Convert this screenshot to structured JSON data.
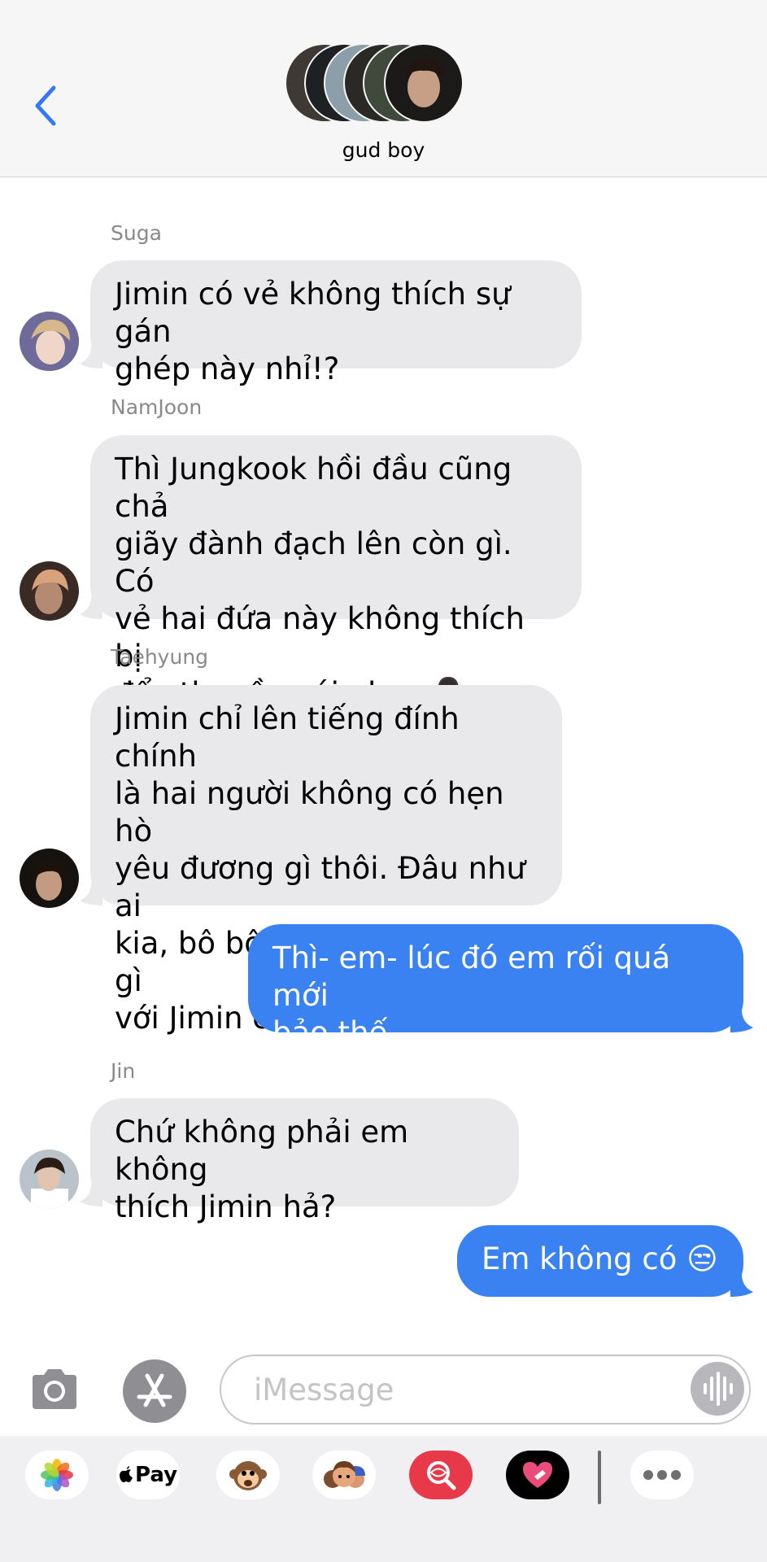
{
  "header": {
    "group_name": "gud boy",
    "back_icon": "chevron-left-icon"
  },
  "messages": [
    {
      "sender": "Suga",
      "text_lines": [
        "Jimin có vẻ không thích sự gán",
        "ghép này nhỉ!?"
      ]
    },
    {
      "sender": "NamJoon",
      "text_lines": [
        "Thì Jungkook hồi đầu cũng chả",
        "giãy đành đạch lên còn gì. Có",
        "vẻ hai đứa này không thích bị",
        "đẩy thuyền với nhau 💁🏻‍♂️"
      ]
    },
    {
      "sender": "Taehyung",
      "text_lines": [
        "Jimin chỉ lên tiếng đính chính",
        "là hai người không có hẹn hò",
        "yêu đương gì thôi. Đâu như ai",
        "kia, bô bô là chả thân thiết gì",
        "với Jimin cả cơ"
      ]
    },
    {
      "sender": "",
      "text_lines": [
        "Thì- em- lúc đó em rối quá mới",
        "bảo thế..."
      ]
    },
    {
      "sender": "Jin",
      "text_lines": [
        "Chứ không phải em không",
        "thích Jimin hả?"
      ]
    },
    {
      "sender": "",
      "text_lines": [
        "Em không có 😒"
      ]
    }
  ],
  "input": {
    "placeholder": "iMessage",
    "camera_icon": "camera-icon",
    "appstore_icon": "app-store-icon",
    "audio_icon": "audio-waveform-icon"
  },
  "apps": [
    {
      "name": "photos-app-icon"
    },
    {
      "name": "apple-pay-app-icon",
      "label": "Pay"
    },
    {
      "name": "animoji-app-icon"
    },
    {
      "name": "memoji-app-icon"
    },
    {
      "name": "gif-search-app-icon"
    },
    {
      "name": "digital-touch-app-icon"
    },
    {
      "name": "more-apps-icon"
    }
  ],
  "colors": {
    "outgoing_bubble": "#3a82f2",
    "incoming_bubble": "#e9e9eb",
    "accent": "#3478f6"
  }
}
